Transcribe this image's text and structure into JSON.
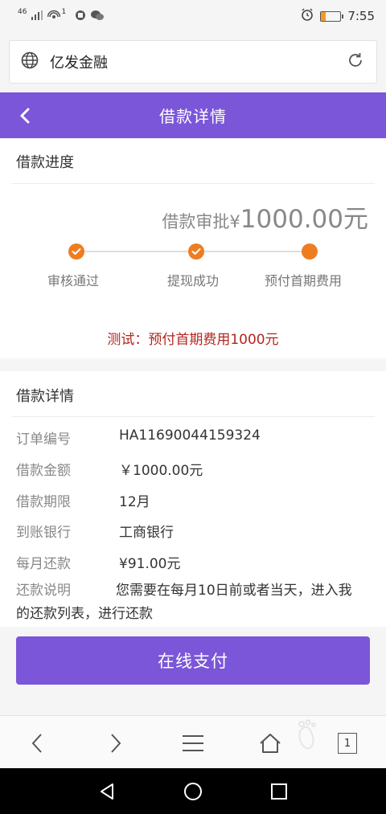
{
  "status_bar": {
    "network": "46",
    "hotspot_count": "1",
    "time": "7:55",
    "battery_level": 0.25
  },
  "browser": {
    "address_text": "亿发金融"
  },
  "header": {
    "title": "借款详情"
  },
  "progress": {
    "section_title": "借款进度",
    "amount_prefix": "借款审批¥",
    "amount_value": "1000.00元",
    "steps": [
      {
        "label": "审核通过",
        "done": true
      },
      {
        "label": "提现成功",
        "done": true
      },
      {
        "label": "预付首期费用",
        "done": false
      }
    ],
    "note": "测试：预付首期费用1000元"
  },
  "details": {
    "section_title": "借款详情",
    "rows": [
      {
        "label": "订单编号",
        "value": "HA11690044159324"
      },
      {
        "label": "借款金额",
        "value": "￥1000.00元"
      },
      {
        "label": "借款期限",
        "value": "12月"
      },
      {
        "label": "到账银行",
        "value": "工商银行"
      },
      {
        "label": "每月还款",
        "value": "¥91.00元"
      }
    ],
    "desc_label": "还款说明",
    "desc_text": "您需要在每月10日前或者当天，进入我的还款列表，进行还款"
  },
  "pay_button": {
    "label": "在线支付"
  },
  "browser_nav": {
    "tab_count": "1"
  },
  "colors": {
    "primary": "#7b56d9",
    "step_active": "#ee7d22",
    "note_red": "#b3261e"
  }
}
